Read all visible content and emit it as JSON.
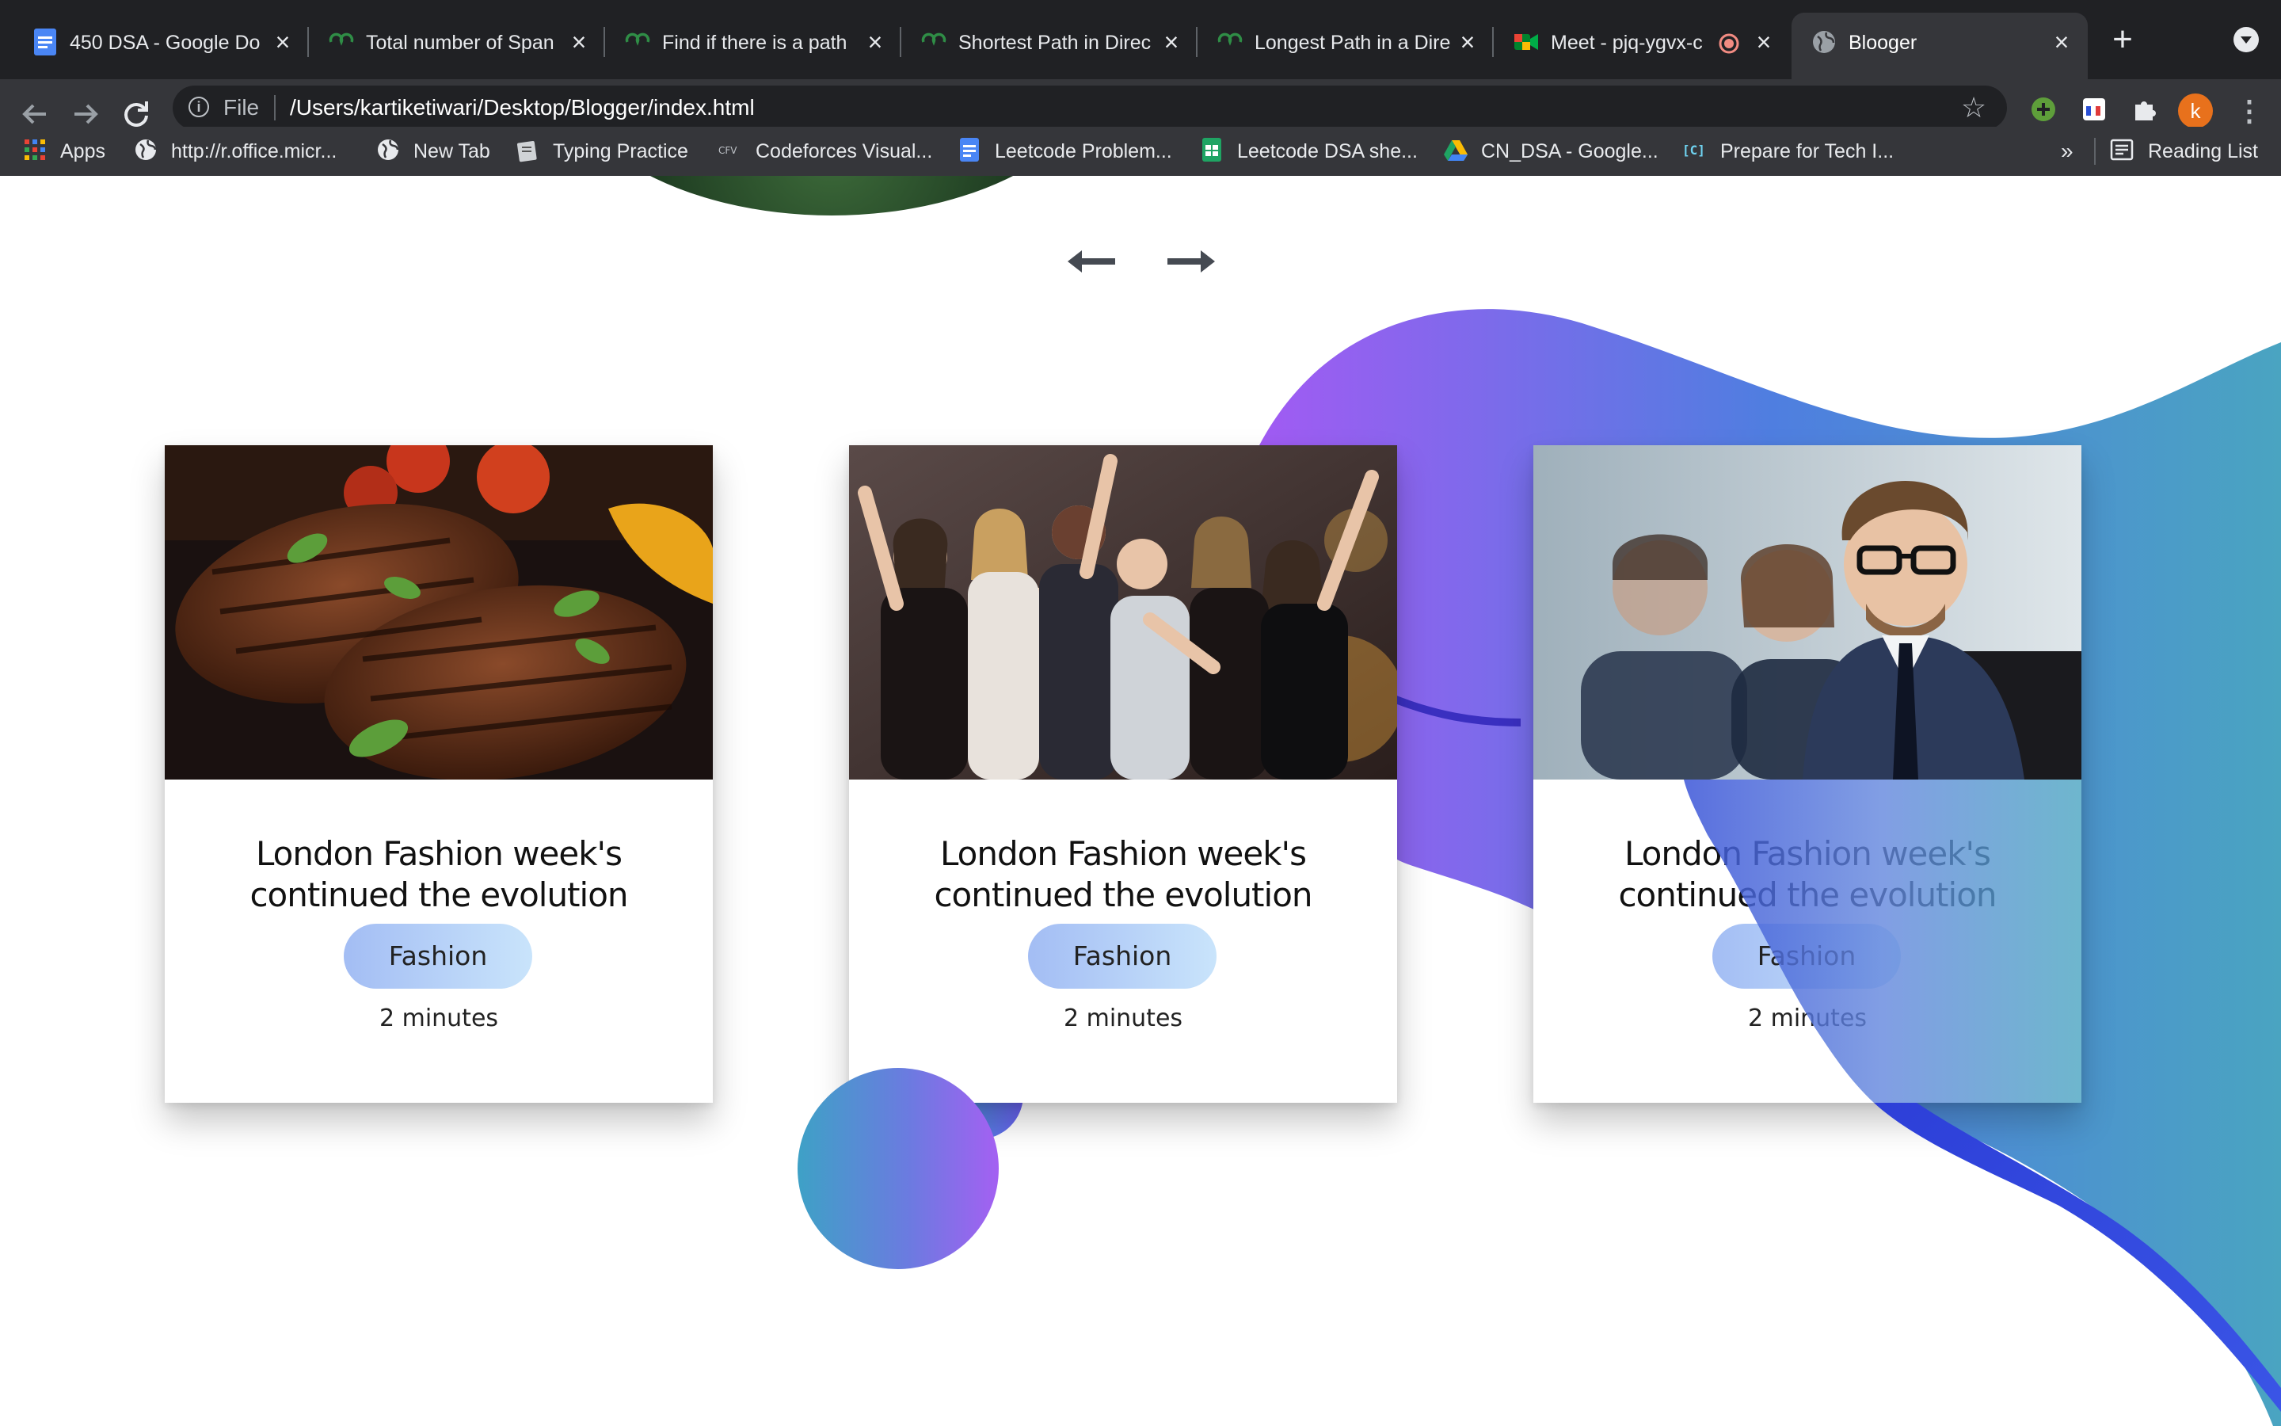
{
  "browser": {
    "tabs": [
      {
        "title": "450 DSA - Google Do",
        "favicon": "google-docs-icon",
        "active": false
      },
      {
        "title": "Total number of Span",
        "favicon": "geeksforgeeks-icon",
        "active": false
      },
      {
        "title": "Find if there is a path",
        "favicon": "geeksforgeeks-icon",
        "active": false
      },
      {
        "title": "Shortest Path in Direc",
        "favicon": "geeksforgeeks-icon",
        "active": false
      },
      {
        "title": "Longest Path in a Dire",
        "favicon": "geeksforgeeks-icon",
        "active": false
      },
      {
        "title": "Meet - pjq-ygvx-c",
        "favicon": "google-meet-icon",
        "active": false,
        "recording": true
      },
      {
        "title": "Blooger",
        "favicon": "globe-icon",
        "active": true
      }
    ],
    "new_tab": "+",
    "address": {
      "scheme_label": "File",
      "url": "/Users/kartiketiwari/Desktop/Blogger/index.html"
    },
    "profile_initial": "k",
    "bookmarks": [
      {
        "label": "Apps",
        "icon": "apps-grid-icon"
      },
      {
        "label": "http://r.office.micr...",
        "icon": "globe-icon"
      },
      {
        "label": "New Tab",
        "icon": "globe-icon"
      },
      {
        "label": "Typing Practice",
        "icon": "typing-icon"
      },
      {
        "label": "Codeforces Visual...",
        "icon": "cfv-icon"
      },
      {
        "label": "Leetcode Problem...",
        "icon": "google-docs-icon"
      },
      {
        "label": "Leetcode DSA she...",
        "icon": "google-sheets-icon"
      },
      {
        "label": "CN_DSA - Google...",
        "icon": "google-drive-icon"
      },
      {
        "label": "Prepare for Tech I...",
        "icon": "codechef-icon"
      }
    ],
    "bookmarks_more": "»",
    "reading_list": "Reading List"
  },
  "page": {
    "colors": {
      "wave_purple": "#a15bf3",
      "wave_blue": "#4f7ee0",
      "wave_teal": "#4aa4c1",
      "tag_start": "#a3bdf4",
      "tag_end": "#c9e4fb"
    },
    "cards": [
      {
        "title": "London Fashion week's continued the evolution",
        "tag": "Fashion",
        "read_time": "2 minutes",
        "image": "grilled-steak-photo"
      },
      {
        "title": "London Fashion week's continued the evolution",
        "tag": "Fashion",
        "read_time": "2 minutes",
        "image": "party-crowd-photo"
      },
      {
        "title": "London Fashion week's continued the evolution",
        "tag": "Fashion",
        "read_time": "2 minutes",
        "image": "business-people-photo"
      }
    ]
  }
}
